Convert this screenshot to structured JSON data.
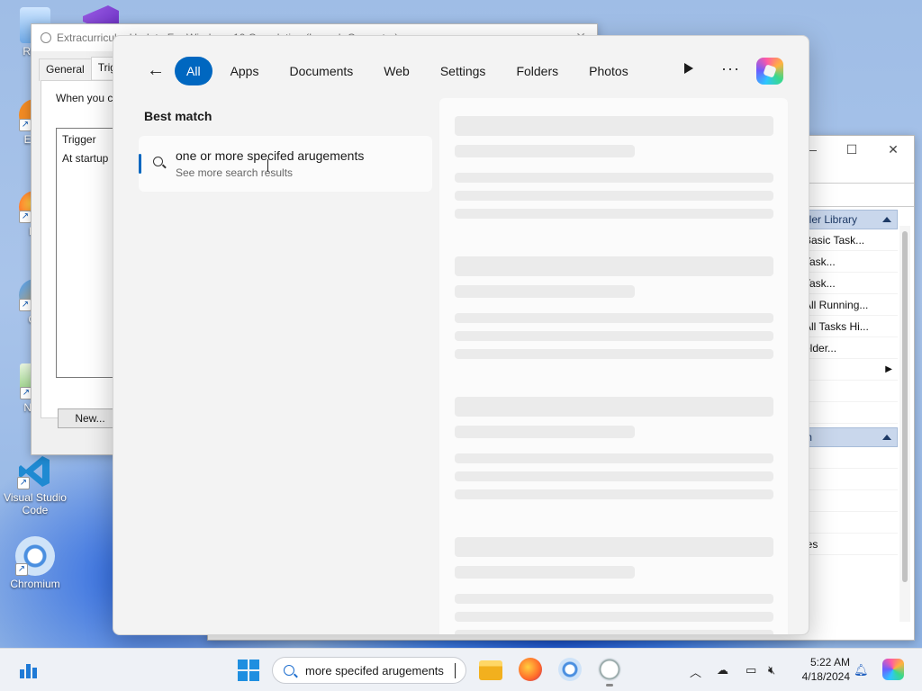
{
  "desktop": {
    "icons": [
      {
        "label": "Recy"
      },
      {
        "label": "Ever"
      },
      {
        "label": "Fir"
      },
      {
        "label": "Git"
      },
      {
        "label": "Note"
      },
      {
        "label": "Visual Studio Code"
      },
      {
        "label": "Chromium"
      }
    ]
  },
  "props_window": {
    "title": "Extracurricular Update For Windows 10 Cumulative (Launch Computer)",
    "tabs": [
      "General",
      "Trig"
    ],
    "description": "When you cr",
    "trigger_header": "Trigger",
    "trigger_rows": [
      "At startup"
    ],
    "new_button": "New..."
  },
  "task_scheduler": {
    "sections": [
      {
        "label": "uler Library",
        "items": [
          "Basic Task...",
          "Task...",
          "Task...",
          "All Running...",
          "All Tasks Hi...",
          "older...",
          ""
        ]
      },
      {
        "label": "m",
        "items": [
          "",
          "",
          "",
          ".",
          "ies",
          ""
        ]
      }
    ]
  },
  "search": {
    "filters": [
      "All",
      "Apps",
      "Documents",
      "Web",
      "Settings",
      "Folders",
      "Photos"
    ],
    "active_filter": "All",
    "best_match_label": "Best match",
    "best_match": {
      "title": "one or more specifed arugements",
      "subtitle": "See more search results"
    }
  },
  "taskbar": {
    "search_text": "more specifed arugements",
    "clock_time": "5:22 AM",
    "clock_date": "4/18/2024",
    "accent_color": "#0067c0"
  }
}
